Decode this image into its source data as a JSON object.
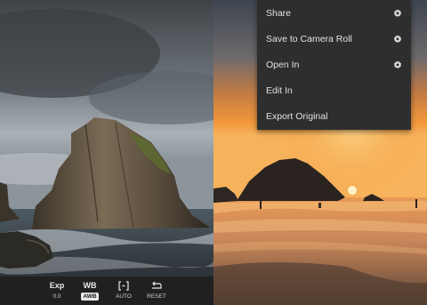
{
  "toolbar": {
    "exposure": {
      "label": "Exp",
      "value": "0.0",
      "icon": "exposure-text"
    },
    "white_balance": {
      "label": "WB",
      "value": "AWB",
      "icon": "wb-text"
    },
    "auto": {
      "label": "AUTO",
      "icon": "auto-bracket-icon"
    },
    "reset": {
      "label": "RESET",
      "icon": "reset-arrow-icon"
    }
  },
  "menu": {
    "items": [
      {
        "label": "Share",
        "icon": "gear-icon"
      },
      {
        "label": "Save to Camera Roll",
        "icon": "gear-icon"
      },
      {
        "label": "Open In",
        "icon": "gear-icon"
      },
      {
        "label": "Edit In"
      },
      {
        "label": "Export Original"
      }
    ]
  },
  "colors": {
    "toolbar_bg": "#202020",
    "menu_bg": "#2e2e2e",
    "menu_text": "#e2e2e2",
    "sunset_orange": "#f08a2a"
  }
}
